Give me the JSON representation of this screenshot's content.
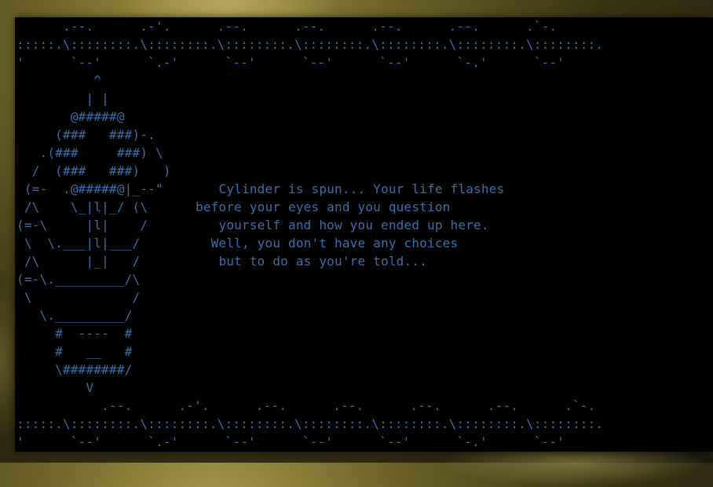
{
  "screen": {
    "background_color": "#010101",
    "text_color": "#3a6ea8"
  },
  "border_top": "      .--.      .-'.      .--.      .--.      .--.      .--.      .`-.\n:::::.\\::::::::.\\::::::::.\\::::::::.\\::::::::.\\::::::::.\\::::::::.\\::::::::.\n'      `--'      `.-'      `--'      `--'      `--'      `-.'      `--'",
  "lamp_art": "          ^\n         | |\n       @#####@\n     (###   ###)-.\n   .(###     ###) \\\n  /  (###   ###)   )\n (=-  .@#####@|_--\"\n /\\    \\_|l|_/ (\\\n(=-\\     |l|    /\n \\  \\.___|l|___/\n /\\      |_|   /\n(=-\\._________/\\\n \\             /\n   \\._________/\n     #  ----  #\n     #   __   #\n     \\########/\n         V",
  "message": "   Cylinder is spun... Your life flashes\nbefore your eyes and you question\n   yourself and how you ended up here.\n  Well, you don't have any choices\n   but to do as you're told...",
  "border_bottom": "           .--.      .-'.      .--.      .--.      .--.      .--.      .`-.\n:::::.\\::::::::.\\::::::::.\\::::::::.\\::::::::.\\::::::::.\\::::::::.\\::::::::.\n'      `--'      `.-'      `--'      `--'      `--'      `-.'      `--'"
}
